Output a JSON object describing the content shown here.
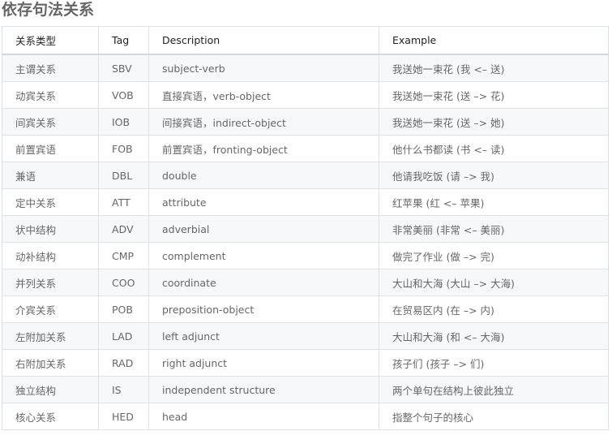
{
  "page_title": "依存句法关系",
  "table": {
    "headers": {
      "type": "关系类型",
      "tag": "Tag",
      "description": "Description",
      "example": "Example"
    },
    "rows": [
      {
        "type": "主谓关系",
        "tag": "SBV",
        "description": "subject-verb",
        "example": "我送她一束花 (我 <– 送)"
      },
      {
        "type": "动宾关系",
        "tag": "VOB",
        "description": "直接宾语，verb-object",
        "example": "我送她一束花 (送 –> 花)"
      },
      {
        "type": "间宾关系",
        "tag": "IOB",
        "description": "间接宾语，indirect-object",
        "example": "我送她一束花 (送 –> 她)"
      },
      {
        "type": "前置宾语",
        "tag": "FOB",
        "description": "前置宾语，fronting-object",
        "example": "他什么书都读 (书 <– 读)"
      },
      {
        "type": "兼语",
        "tag": "DBL",
        "description": "double",
        "example": "他请我吃饭 (请 –> 我)"
      },
      {
        "type": "定中关系",
        "tag": "ATT",
        "description": "attribute",
        "example": "红苹果 (红 <– 苹果)"
      },
      {
        "type": "状中结构",
        "tag": "ADV",
        "description": "adverbial",
        "example": "非常美丽 (非常 <– 美丽)"
      },
      {
        "type": "动补结构",
        "tag": "CMP",
        "description": "complement",
        "example": "做完了作业 (做 –> 完)"
      },
      {
        "type": "并列关系",
        "tag": "COO",
        "description": "coordinate",
        "example": "大山和大海 (大山 –> 大海)"
      },
      {
        "type": "介宾关系",
        "tag": "POB",
        "description": "preposition-object",
        "example": "在贸易区内 (在 –> 内)"
      },
      {
        "type": "左附加关系",
        "tag": "LAD",
        "description": "left adjunct",
        "example": "大山和大海 (和 <– 大海)"
      },
      {
        "type": "右附加关系",
        "tag": "RAD",
        "description": "right adjunct",
        "example": "孩子们 (孩子 –> 们)"
      },
      {
        "type": "独立结构",
        "tag": "IS",
        "description": "independent structure",
        "example": "两个单句在结构上彼此独立"
      },
      {
        "type": "核心关系",
        "tag": "HED",
        "description": "head",
        "example": "指整个句子的核心"
      }
    ]
  }
}
